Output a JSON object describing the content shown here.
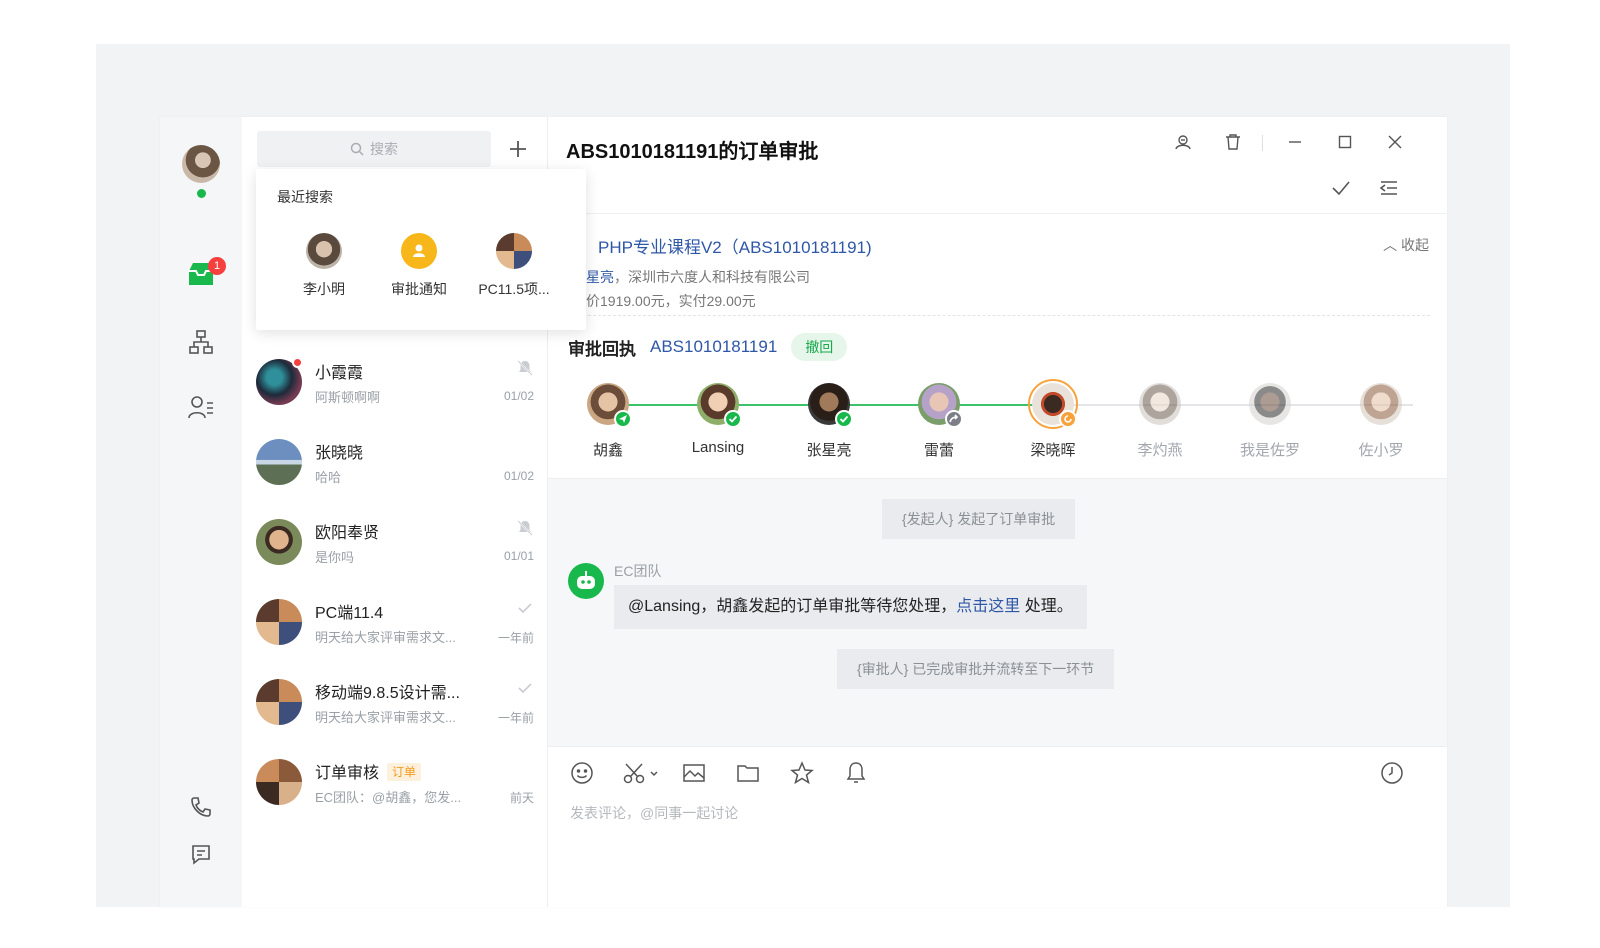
{
  "rail": {
    "inbox_badge": "1",
    "icons": [
      "inbox-icon",
      "org-chart-icon",
      "contacts-icon",
      "phone-icon",
      "feedback-icon"
    ]
  },
  "search": {
    "placeholder": "搜索",
    "recent_title": "最近搜索",
    "recent": [
      {
        "name": "李小明"
      },
      {
        "name": "审批通知"
      },
      {
        "name": "PC11.5项..."
      }
    ]
  },
  "conversations": [
    {
      "name": "小霞霞",
      "preview": "阿斯顿啊啊",
      "time": "01/02",
      "unread_dot": true,
      "status": "muted"
    },
    {
      "name": "张晓晓",
      "preview": "哈哈",
      "time": "01/02"
    },
    {
      "name": "欧阳奉贤",
      "preview": "是你吗",
      "time": "01/01",
      "status": "muted"
    },
    {
      "name": "PC端11.4",
      "preview": "明天给大家评审需求文...",
      "time": "一年前",
      "status": "read"
    },
    {
      "name": "移动端9.8.5设计需...",
      "preview": "明天给大家评审需求文...",
      "time": "一年前",
      "status": "read"
    },
    {
      "name": "订单审核",
      "tag": "订单",
      "preview": "EC团队：@胡鑫，您发...",
      "time": "前天"
    }
  ],
  "header": {
    "title": "ABS1010181191的订单审批",
    "sub_left": ")"
  },
  "product": {
    "title": "PHP专业课程V2（ABS1010181191)",
    "collapse_label": "收起",
    "line1_link": "星亮",
    "line1_rest": "，深圳市六度人和科技有限公司",
    "line2": "价1919.00元，实付29.00元"
  },
  "receipt": {
    "label": "审批回执",
    "code": "ABS1010181191",
    "revoke_label": "撤回"
  },
  "flow": [
    {
      "name": "胡鑫",
      "state": "started"
    },
    {
      "name": "Lansing",
      "state": "approved"
    },
    {
      "name": "张星亮",
      "state": "approved"
    },
    {
      "name": "雷蕾",
      "state": "forwarded"
    },
    {
      "name": "梁晓晖",
      "state": "current"
    },
    {
      "name": "李灼燕",
      "state": "pending"
    },
    {
      "name": "我是佐罗",
      "state": "pending"
    },
    {
      "name": "佐小罗",
      "state": "pending"
    }
  ],
  "chat": {
    "system1": "{发起人} 发起了订单审批",
    "sender": "EC团队",
    "msg_prefix": "@Lansing，胡鑫发起的订单审批等待您处理，",
    "msg_link": "点击这里",
    "msg_suffix": " 处理。",
    "system2": "{审批人} 已完成审批并流转至下一环节"
  },
  "composer": {
    "placeholder": "发表评论，@同事一起讨论",
    "tools": [
      "emoji-icon",
      "scissors-icon",
      "image-icon",
      "folder-icon",
      "star-icon",
      "bell-icon",
      "history-icon"
    ]
  },
  "colors": {
    "brand_green": "#19b84c",
    "link_blue": "#2f57a8",
    "badge_red": "#f5403f",
    "current_orange": "#f7a23b"
  }
}
